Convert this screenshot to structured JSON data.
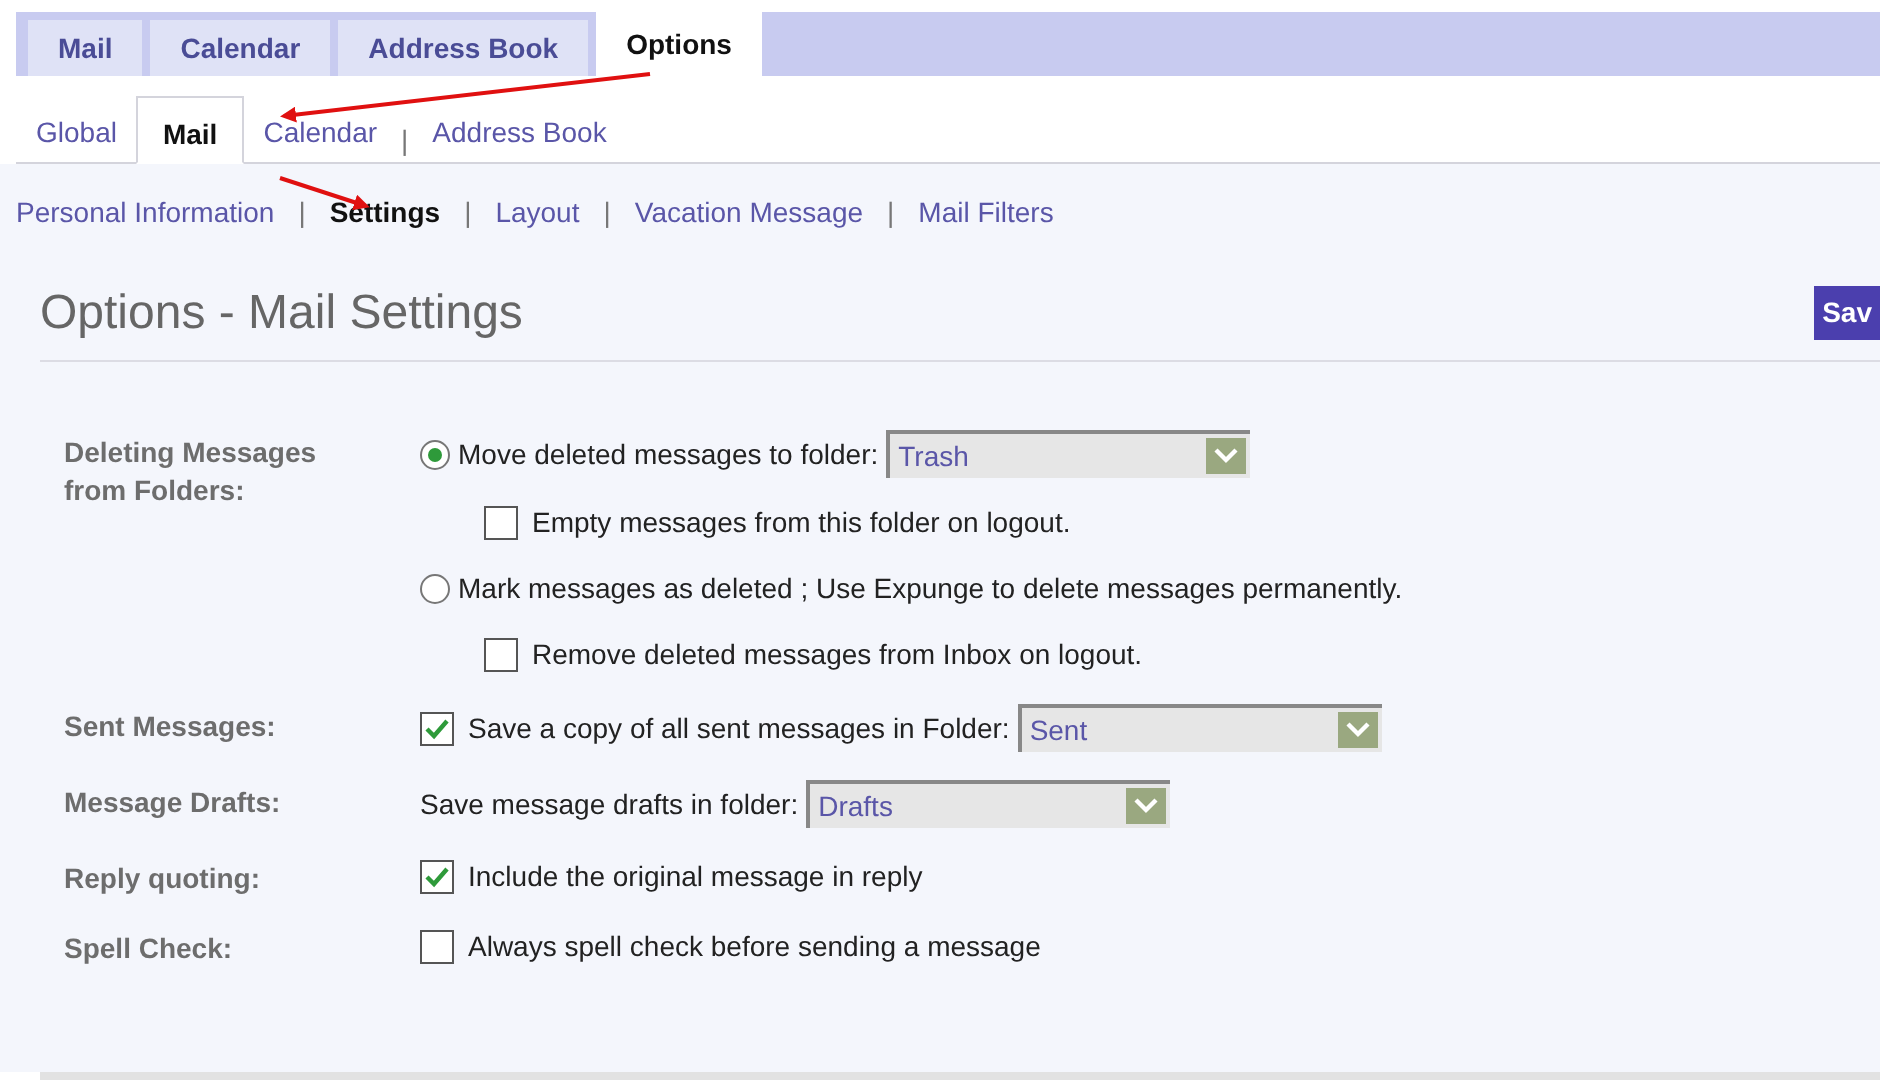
{
  "main_tabs": [
    {
      "label": "Mail",
      "selected": false
    },
    {
      "label": "Calendar",
      "selected": false
    },
    {
      "label": "Address Book",
      "selected": false
    },
    {
      "label": "Options",
      "selected": true
    }
  ],
  "option_tabs": [
    {
      "label": "Global",
      "selected": false
    },
    {
      "label": "Mail",
      "selected": true
    },
    {
      "label": "Calendar",
      "selected": false
    },
    {
      "label": "Address Book",
      "selected": false,
      "divider": "|"
    }
  ],
  "sub_tabs": [
    {
      "label": "Personal Information",
      "selected": false
    },
    {
      "label": "Settings",
      "selected": true,
      "divider": "|"
    },
    {
      "label": "Layout",
      "selected": false,
      "divider": "|"
    },
    {
      "label": "Vacation Message",
      "selected": false,
      "divider": "|"
    },
    {
      "label": "Mail Filters",
      "selected": false,
      "divider": "|"
    }
  ],
  "page_title": "Options - Mail Settings",
  "save_button": "Sav",
  "settings": [
    {
      "label": "Deleting Messages from Folders:",
      "controls": [
        {
          "kind": "radio",
          "text": "Move deleted messages to folder:",
          "selected": true,
          "folder": "Trash",
          "children": [
            {
              "kind": "checkbox",
              "text": "Empty messages from this folder on logout.",
              "checked": false
            }
          ]
        },
        {
          "kind": "radio",
          "text": "Mark messages as deleted ; Use Expunge to delete messages permanently.",
          "selected": false,
          "children": [
            {
              "kind": "checkbox",
              "text": "Remove deleted messages from Inbox on logout.",
              "checked": false
            }
          ]
        }
      ]
    },
    {
      "label": "Sent Messages:",
      "controls": [
        {
          "kind": "checkbox",
          "text": "Save a copy of all sent messages in Folder:",
          "checked": true,
          "folder": "Sent"
        }
      ]
    },
    {
      "label": "Message Drafts:",
      "controls": [
        {
          "kind": "text",
          "text": "Save message drafts in folder:",
          "folder": "Drafts"
        }
      ]
    },
    {
      "label": "Reply quoting:",
      "controls": [
        {
          "kind": "checkbox",
          "text": "Include the original message in reply",
          "checked": true
        }
      ]
    },
    {
      "label": "Spell Check:",
      "controls": [
        {
          "kind": "checkbox",
          "text": "Always spell check before sending a message",
          "checked": false
        }
      ]
    }
  ]
}
